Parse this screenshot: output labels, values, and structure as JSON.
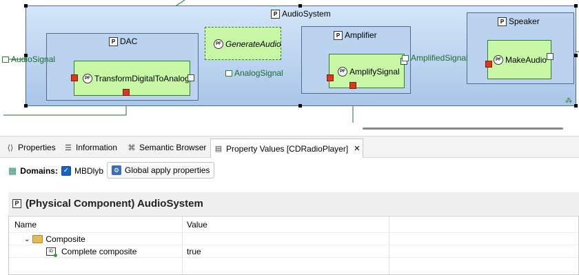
{
  "diagram": {
    "system": {
      "name": "AudioSystem",
      "icon": "physical-component-icon",
      "icon_text": "P"
    },
    "components": {
      "dac": {
        "name": "DAC",
        "icon_text": "P"
      },
      "amplifier": {
        "name": "Amplifier",
        "icon_text": "P"
      },
      "speaker": {
        "name": "Speaker",
        "icon_text": "P"
      }
    },
    "functions": {
      "transform": {
        "name": "TransformDigitalToAnalog",
        "icon_text": "PF"
      },
      "generate": {
        "name": "GenerateAudio",
        "icon_text": "PF"
      },
      "amplify": {
        "name": "AmplifySignal",
        "icon_text": "PF"
      },
      "make_audio": {
        "name": "MakeAudio",
        "icon_text": "PF"
      }
    },
    "exchanges": {
      "audio_signal": "AudioSignal",
      "analog_signal": "AnalogSignal",
      "amplified_signal": "AmplifiedSignal"
    },
    "colors": {
      "system_fill": "#c5dcf4",
      "component_fill": "#bcd3ef",
      "function_fill": "#c8f7a6",
      "exchange_line": "#1c6b35",
      "port_red": "#d93a1e"
    }
  },
  "tabs": [
    {
      "label": "Properties",
      "icon": "properties-icon"
    },
    {
      "label": "Information",
      "icon": "information-icon"
    },
    {
      "label": "Semantic Browser",
      "icon": "semantic-browser-icon"
    },
    {
      "label": "Property Values [CDRadioPlayer]",
      "icon": "property-values-icon",
      "active": true,
      "close": "✕"
    }
  ],
  "domains": {
    "label": "Domains:",
    "domain_name": "MBDlyb",
    "checked": true,
    "global_apply_label": "Global apply properties"
  },
  "properties": {
    "title": "(Physical Component) AudioSystem",
    "columns": [
      "Name",
      "Value"
    ],
    "rows": [
      {
        "name": "Composite",
        "value": "",
        "expanded": true,
        "icon": "folder-icon"
      },
      {
        "name": "Complete composite",
        "value": "true",
        "icon": "complete-composite-icon"
      }
    ]
  }
}
